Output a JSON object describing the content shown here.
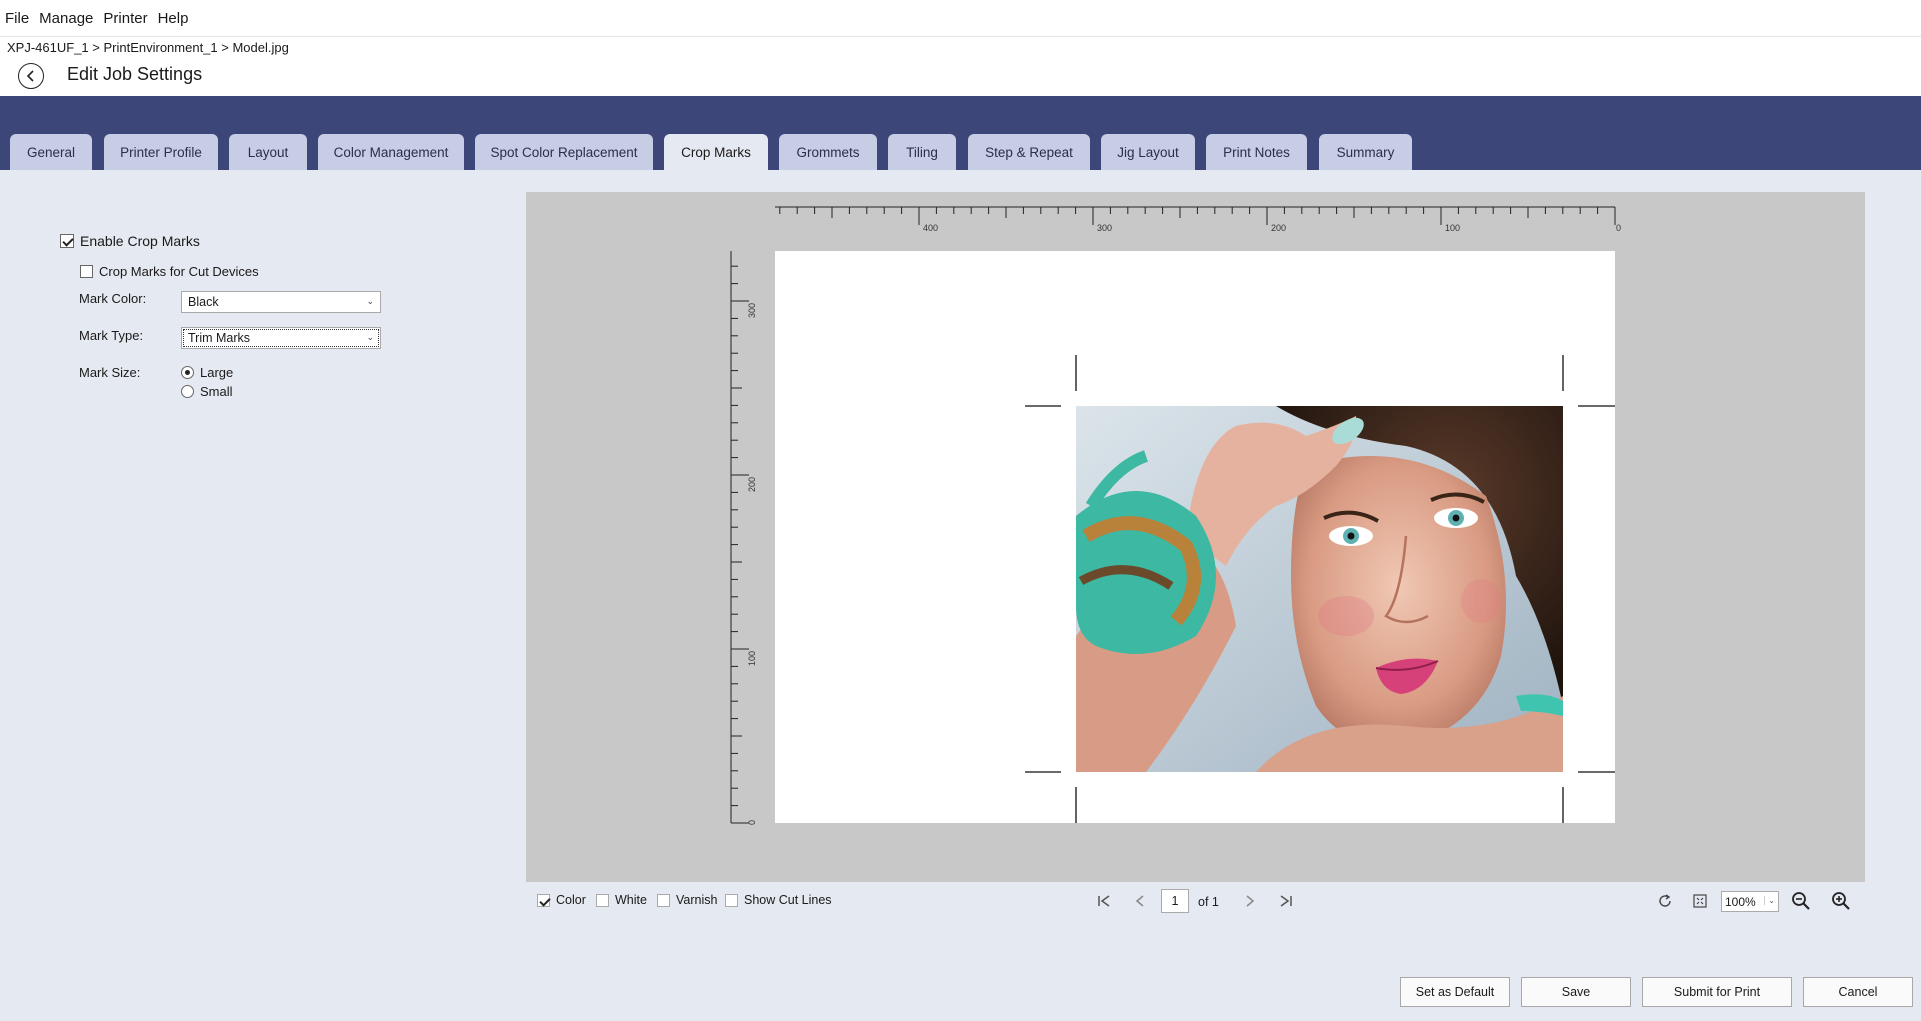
{
  "menu": [
    "File",
    "Manage",
    "Printer",
    "Help"
  ],
  "breadcrumb": "XPJ-461UF_1 > PrintEnvironment_1 > Model.jpg",
  "title": "Edit Job Settings",
  "tabs": [
    {
      "label": "General"
    },
    {
      "label": "Printer Profile"
    },
    {
      "label": "Layout"
    },
    {
      "label": "Color Management"
    },
    {
      "label": "Spot Color Replacement"
    },
    {
      "label": "Crop Marks",
      "active": true
    },
    {
      "label": "Grommets"
    },
    {
      "label": "Tiling"
    },
    {
      "label": "Step & Repeat"
    },
    {
      "label": "Jig Layout"
    },
    {
      "label": "Print Notes"
    },
    {
      "label": "Summary"
    }
  ],
  "crop_marks": {
    "enable_label": "Enable Crop Marks",
    "enable_checked": true,
    "cut_devices_label": "Crop Marks for Cut Devices",
    "cut_devices_checked": false,
    "mark_color_label": "Mark Color:",
    "mark_color_value": "Black",
    "mark_type_label": "Mark Type:",
    "mark_type_value": "Trim Marks",
    "mark_size_label": "Mark Size:",
    "mark_size_options": [
      "Large",
      "Small"
    ],
    "mark_size_selected": "Large"
  },
  "preview": {
    "ruler_top_labels": [
      "400",
      "300",
      "200",
      "100",
      "0"
    ],
    "ruler_left_labels": [
      "300",
      "200",
      "100",
      "0"
    ]
  },
  "toolbar": {
    "color_label": "Color",
    "color_checked": true,
    "white_label": "White",
    "varnish_label": "Varnish",
    "cut_lines_label": "Show Cut Lines",
    "page_current": "1",
    "page_of": "of 1",
    "zoom": "100%"
  },
  "buttons": {
    "set_default": "Set as Default",
    "save": "Save",
    "submit": "Submit for Print",
    "cancel": "Cancel"
  },
  "colors": {
    "tab_strip": "#3c4678",
    "tab_inactive": "#c7cde4",
    "background": "#e5e9f1",
    "preview_bg": "#c8c8c8"
  }
}
